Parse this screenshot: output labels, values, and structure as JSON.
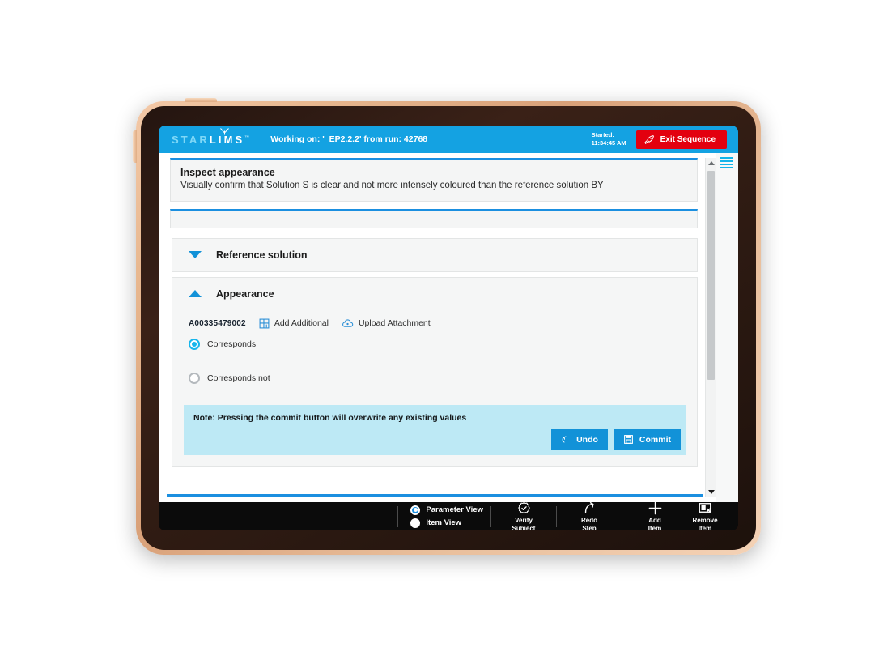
{
  "header": {
    "brand_star": "STAR",
    "brand_lims": "LIMS",
    "brand_tm": "™",
    "working_on": "Working on: '_EP2.2.2' from run: 42768",
    "started_label": "Started:",
    "started_time": "11:34:45 AM",
    "exit_button": "Exit Sequence",
    "exit_icon": "rocket-icon",
    "menu_icon": "hamburger-menu-icon",
    "accent_blue": "#14a2e2",
    "exit_red": "#e3000f"
  },
  "instruction": {
    "title": "Inspect appearance",
    "text": "Visually confirm that Solution S is clear and not more intensely coloured than the reference solution BY"
  },
  "accordions": [
    {
      "title": "Reference solution",
      "state": "collapsed",
      "chevron": "chevron-down-icon"
    },
    {
      "title": "Appearance",
      "state": "expanded",
      "chevron": "chevron-up-icon"
    }
  ],
  "appearance": {
    "sample_id": "A00335479002",
    "add_additional": "Add Additional",
    "add_additional_icon": "add-grid-icon",
    "upload_attachment": "Upload Attachment",
    "upload_attachment_icon": "cloud-upload-icon",
    "options": [
      {
        "label": "Corresponds",
        "selected": true
      },
      {
        "label": "Corresponds not",
        "selected": false
      }
    ],
    "note": "Note: Pressing the commit button will overwrite any existing values",
    "undo_label": "Undo",
    "undo_icon": "undo-arrow-icon",
    "commit_label": "Commit",
    "commit_icon": "save-disk-icon"
  },
  "scrollbar": {
    "up_icon": "scroll-up-arrow-icon",
    "down_icon": "scroll-down-arrow-icon"
  },
  "toolbar": {
    "view_options": [
      {
        "label": "Parameter View",
        "selected": true
      },
      {
        "label": "Item View",
        "selected": false
      }
    ],
    "actions": [
      {
        "line1": "Verify",
        "line2": "Subject",
        "icon": "verify-badge-icon"
      },
      {
        "line1": "Redo",
        "line2": "Step",
        "icon": "redo-arrow-icon"
      },
      {
        "line1": "Add",
        "line2": "Item",
        "icon": "plus-icon"
      },
      {
        "line1": "Remove",
        "line2": "Item",
        "icon": "remove-box-icon"
      }
    ]
  }
}
